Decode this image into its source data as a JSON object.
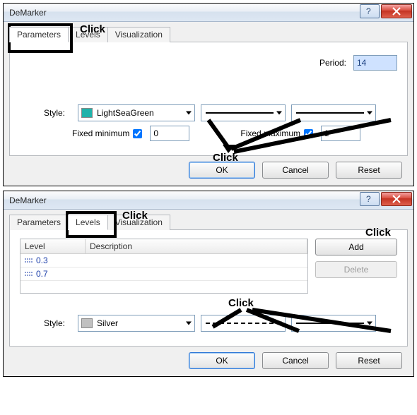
{
  "dialog1": {
    "title": "DeMarker",
    "tabs": {
      "parameters": "Parameters",
      "levels": "Levels",
      "visualization": "Visualization"
    },
    "period_label": "Period:",
    "period_value": "14",
    "style_label": "Style:",
    "color": {
      "name": "LightSeaGreen",
      "hex": "#20B2AA"
    },
    "fixmin_label": "Fixed minimum",
    "fixmin_checked": true,
    "fixmin_value": "0",
    "fixmax_label": "Fixed maximum",
    "fixmax_checked": true,
    "fixmax_value": "1",
    "ok": "OK",
    "cancel": "Cancel",
    "reset": "Reset"
  },
  "dialog2": {
    "title": "DeMarker",
    "tabs": {
      "parameters": "Parameters",
      "levels": "Levels",
      "visualization": "Visualization"
    },
    "grid_headers": {
      "level": "Level",
      "desc": "Description"
    },
    "levels": [
      {
        "value": "0.3",
        "desc": ""
      },
      {
        "value": "0.7",
        "desc": ""
      }
    ],
    "add": "Add",
    "delete": "Delete",
    "style_label": "Style:",
    "color": {
      "name": "Silver",
      "hex": "#C0C0C0"
    },
    "ok": "OK",
    "cancel": "Cancel",
    "reset": "Reset"
  },
  "annotations": {
    "click": "Click"
  }
}
